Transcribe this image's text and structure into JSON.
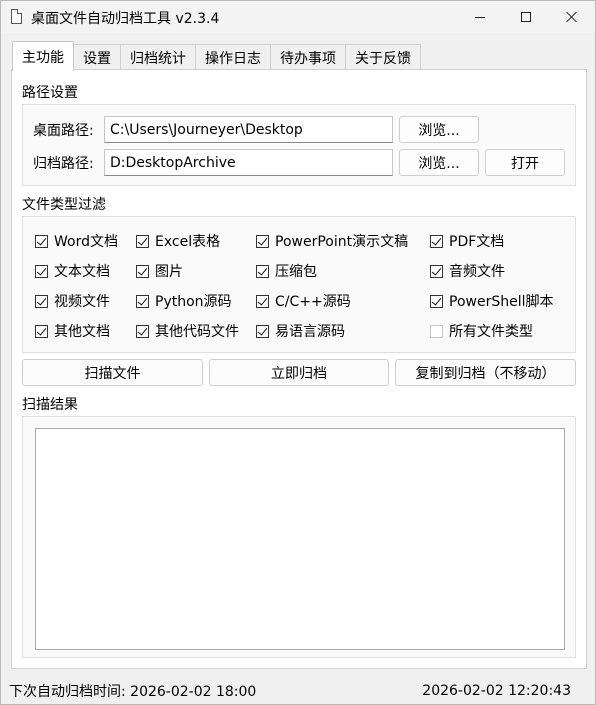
{
  "window": {
    "title": "桌面文件自动归档工具 v2.3.4"
  },
  "tabs": [
    {
      "label": "主功能"
    },
    {
      "label": "设置"
    },
    {
      "label": "归档统计"
    },
    {
      "label": "操作日志"
    },
    {
      "label": "待办事项"
    },
    {
      "label": "关于反馈"
    }
  ],
  "paths": {
    "section_title": "路径设置",
    "desktop_label": "桌面路径:",
    "desktop_value": "C:\\Users\\Journeyer\\Desktop",
    "archive_label": "归档路径:",
    "archive_value": "D:DesktopArchive",
    "browse_label": "浏览...",
    "open_label": "打开"
  },
  "filters": {
    "section_title": "文件类型过滤",
    "items": [
      {
        "label": "Word文档",
        "checked": true
      },
      {
        "label": "Excel表格",
        "checked": true
      },
      {
        "label": "PowerPoint演示文稿",
        "checked": true
      },
      {
        "label": "PDF文档",
        "checked": true
      },
      {
        "label": "文本文档",
        "checked": true
      },
      {
        "label": "图片",
        "checked": true
      },
      {
        "label": "压缩包",
        "checked": true
      },
      {
        "label": "音频文件",
        "checked": true
      },
      {
        "label": "视频文件",
        "checked": true
      },
      {
        "label": "Python源码",
        "checked": true
      },
      {
        "label": "C/C++源码",
        "checked": true
      },
      {
        "label": "PowerShell脚本",
        "checked": true
      },
      {
        "label": "其他文档",
        "checked": true
      },
      {
        "label": "其他代码文件",
        "checked": true
      },
      {
        "label": "易语言源码",
        "checked": true
      },
      {
        "label": "所有文件类型",
        "checked": false
      }
    ]
  },
  "actions": {
    "scan_label": "扫描文件",
    "archive_now_label": "立即归档",
    "copy_label": "复制到归档（不移动）"
  },
  "results": {
    "section_title": "扫描结果"
  },
  "status": {
    "next_archive": "下次自动归档时间: 2026-02-02 18:00",
    "current_time": "2026-02-02 12:20:43"
  }
}
